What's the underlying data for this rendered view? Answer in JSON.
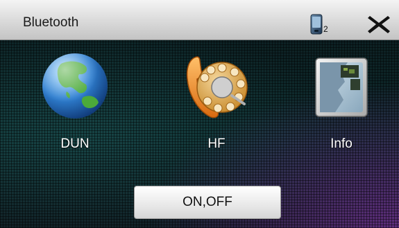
{
  "titlebar": {
    "title": "Bluetooth",
    "phone_icon": "phone-icon",
    "phone_count": "2",
    "close_icon": "close-icon"
  },
  "apps": [
    {
      "label": "DUN",
      "icon": "globe-icon"
    },
    {
      "label": "HF",
      "icon": "rotary-phone-icon"
    },
    {
      "label": "Info",
      "icon": "info-icon"
    }
  ],
  "toggle_button": {
    "label": "ON,OFF"
  }
}
